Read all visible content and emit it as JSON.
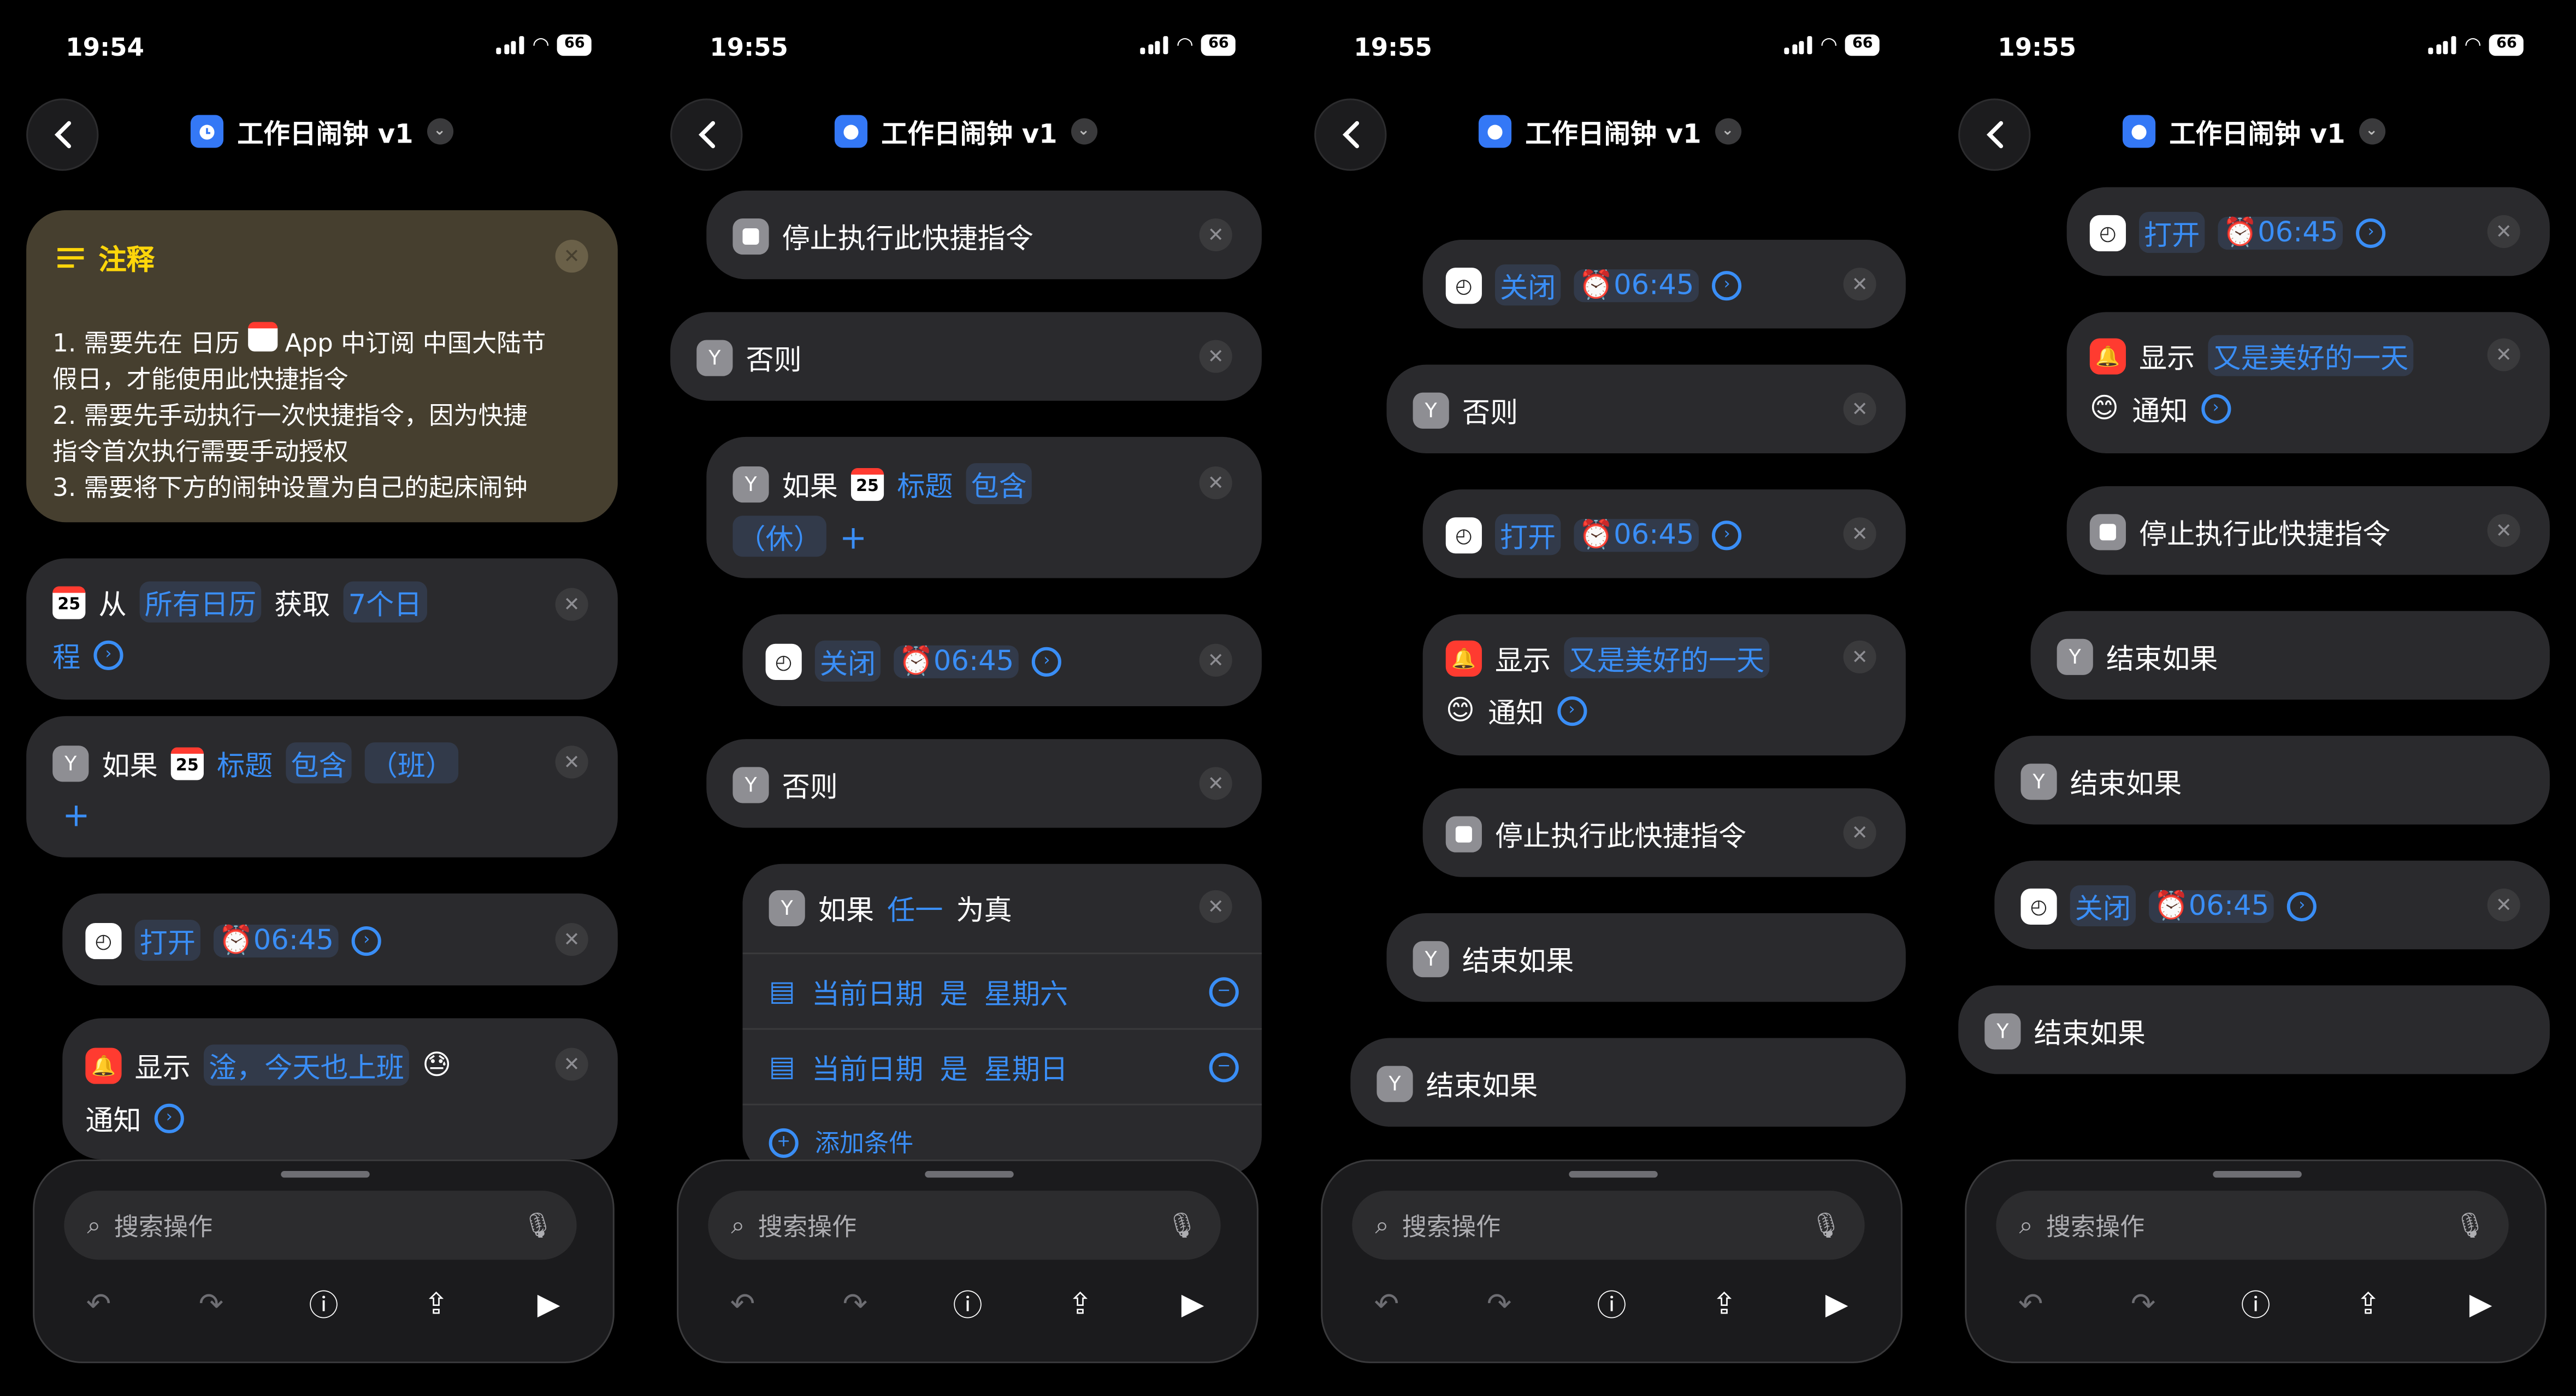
{
  "status": {
    "time_1": "19:54",
    "time_2": "19:55",
    "time_3": "19:55",
    "time_4": "19:55",
    "battery": "66"
  },
  "nav": {
    "title": "工作日闹钟 v1",
    "chevron": "⌄"
  },
  "note": {
    "title": "注释",
    "line1": "1. 需要先在 日历",
    "line1b": "App 中订阅 中国大陆节",
    "line2": "假日，才能使用此快捷指令",
    "line3": "2. 需要先手动执行一次快捷指令，因为快捷",
    "line4": "指令首次执行需要手动授权",
    "line5": "3. 需要将下方的闹钟设置为自己的起床闹钟"
  },
  "actions": {
    "from": "从",
    "all_calendars": "所有日历",
    "get": "获取",
    "seven_days": "7个日",
    "program": "程",
    "if": "如果",
    "title_kw": "标题",
    "contains": "包含",
    "work": "（班）",
    "rest": "（休）",
    "open": "打开",
    "close": "关闭",
    "alarm_time": "06:45",
    "show": "显示",
    "msg_work": "淦，今天也上班",
    "msg_good": "又是美好的一天",
    "notify": "通知",
    "stop": "停止执行此快捷指令",
    "otherwise": "否则",
    "any": "任一",
    "is_true": "为真",
    "current_date": "当前日期",
    "is": "是",
    "saturday": "星期六",
    "sunday": "星期日",
    "add_condition": "添加条件",
    "end_if": "结束如果",
    "plus": "+",
    "cal_day": "25"
  },
  "bottom": {
    "search_placeholder": "搜索操作"
  },
  "colors": {
    "accent": "#3a8ef6",
    "card": "#2a2a2d",
    "note": "#463f2f"
  }
}
